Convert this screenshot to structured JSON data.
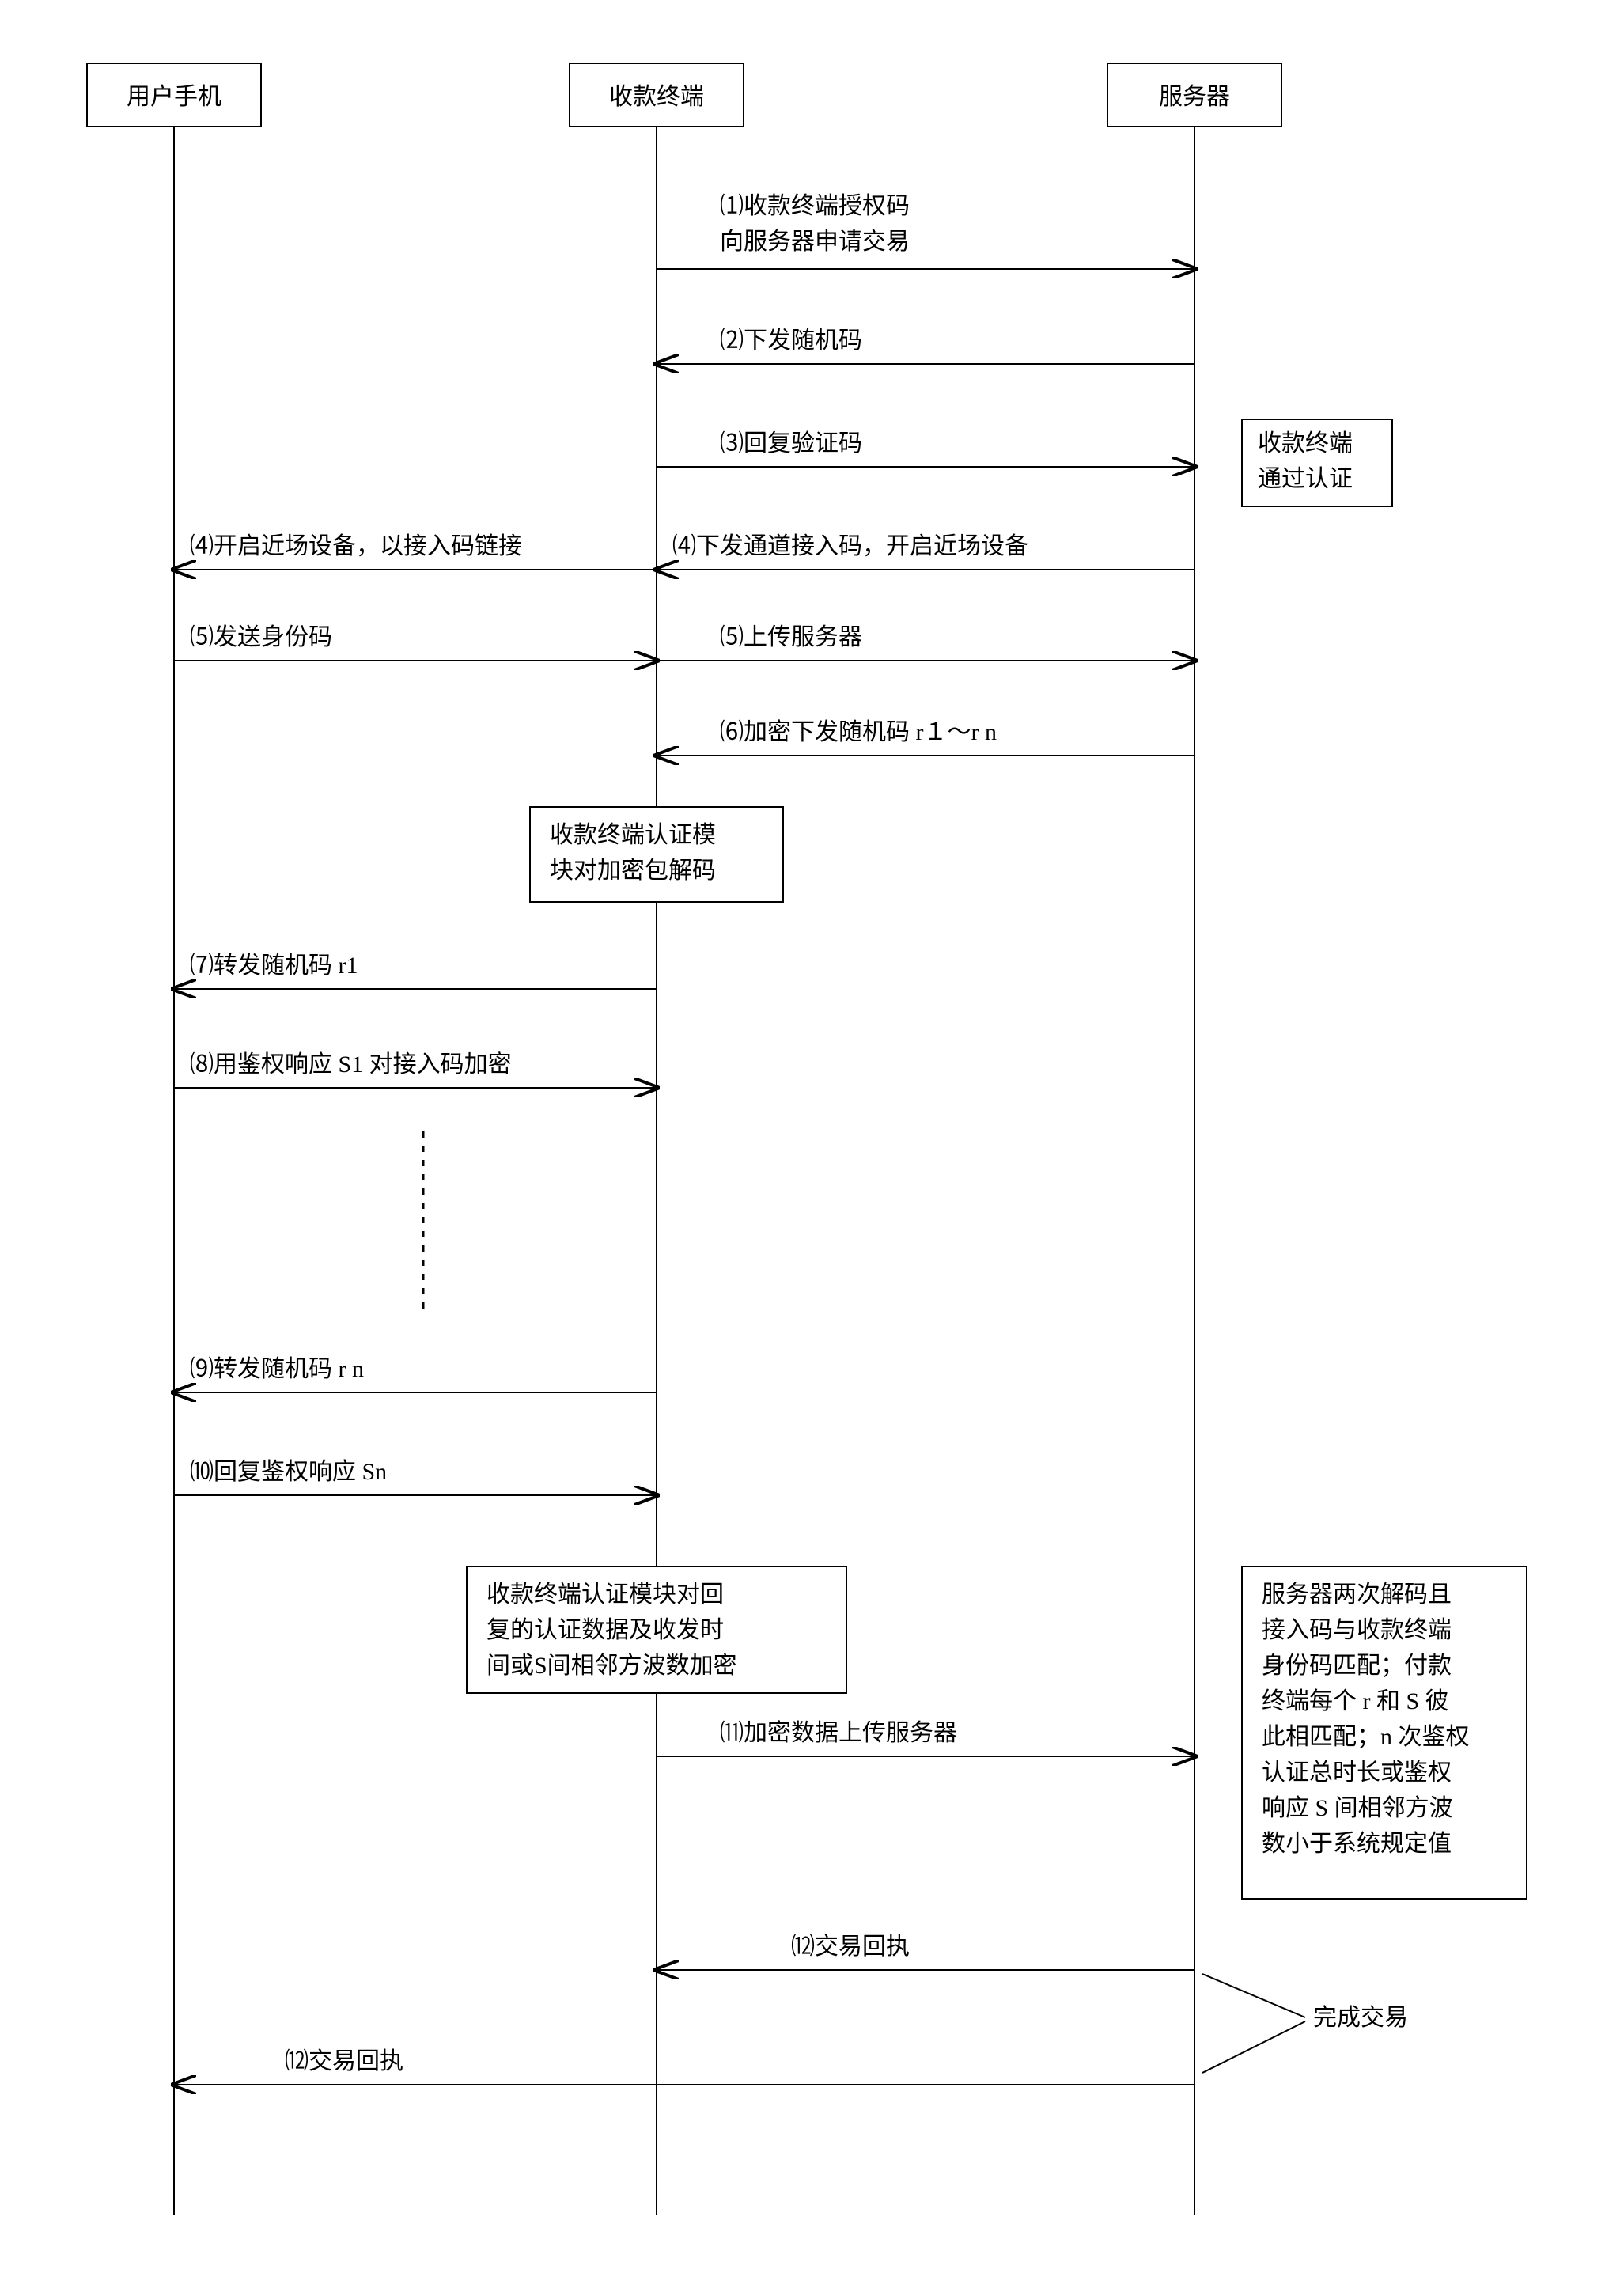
{
  "actors": {
    "user_phone": "用户手机",
    "terminal": "收款终端",
    "server": "服务器"
  },
  "messages": {
    "m1l1": "⑴收款终端授权码",
    "m1l2": "向服务器申请交易",
    "m2": "⑵下发随机码",
    "m3": "⑶回复验证码",
    "m4a": "⑷开启近场设备，以接入码链接",
    "m4b": "⑷下发通道接入码，开启近场设备",
    "m5a": "⑸发送身份码",
    "m5b": "⑸上传服务器",
    "m6": "⑹加密下发随机码 r１～r n",
    "m7": "⑺转发随机码 r1",
    "m8": "⑻用鉴权响应 S1 对接入码加密",
    "m9": "⑼转发随机码 r n",
    "m10": "⑽回复鉴权响应 Sn",
    "m11": "⑾加密数据上传服务器",
    "m12a": "⑿交易回执",
    "m12b": "⑿交易回执"
  },
  "notes": {
    "auth_pass_l1": "收款终端",
    "auth_pass_l2": "通过认证",
    "decode_l1": "收款终端认证模",
    "decode_l2": "块对加密包解码",
    "encrypt_l1": "收款终端认证模块对回",
    "encrypt_l2": "复的认证数据及收发时",
    "encrypt_l3": "间或S间相邻方波数加密",
    "server_l1": "服务器两次解码且",
    "server_l2": "接入码与收款终端",
    "server_l3": "身份码匹配；付款",
    "server_l4": "终端每个 r 和 S 彼",
    "server_l5": "此相匹配；n 次鉴权",
    "server_l6": "认证总时长或鉴权",
    "server_l7": "响应 S 间相邻方波",
    "server_l8": "数小于系统规定值",
    "complete": "完成交易"
  }
}
